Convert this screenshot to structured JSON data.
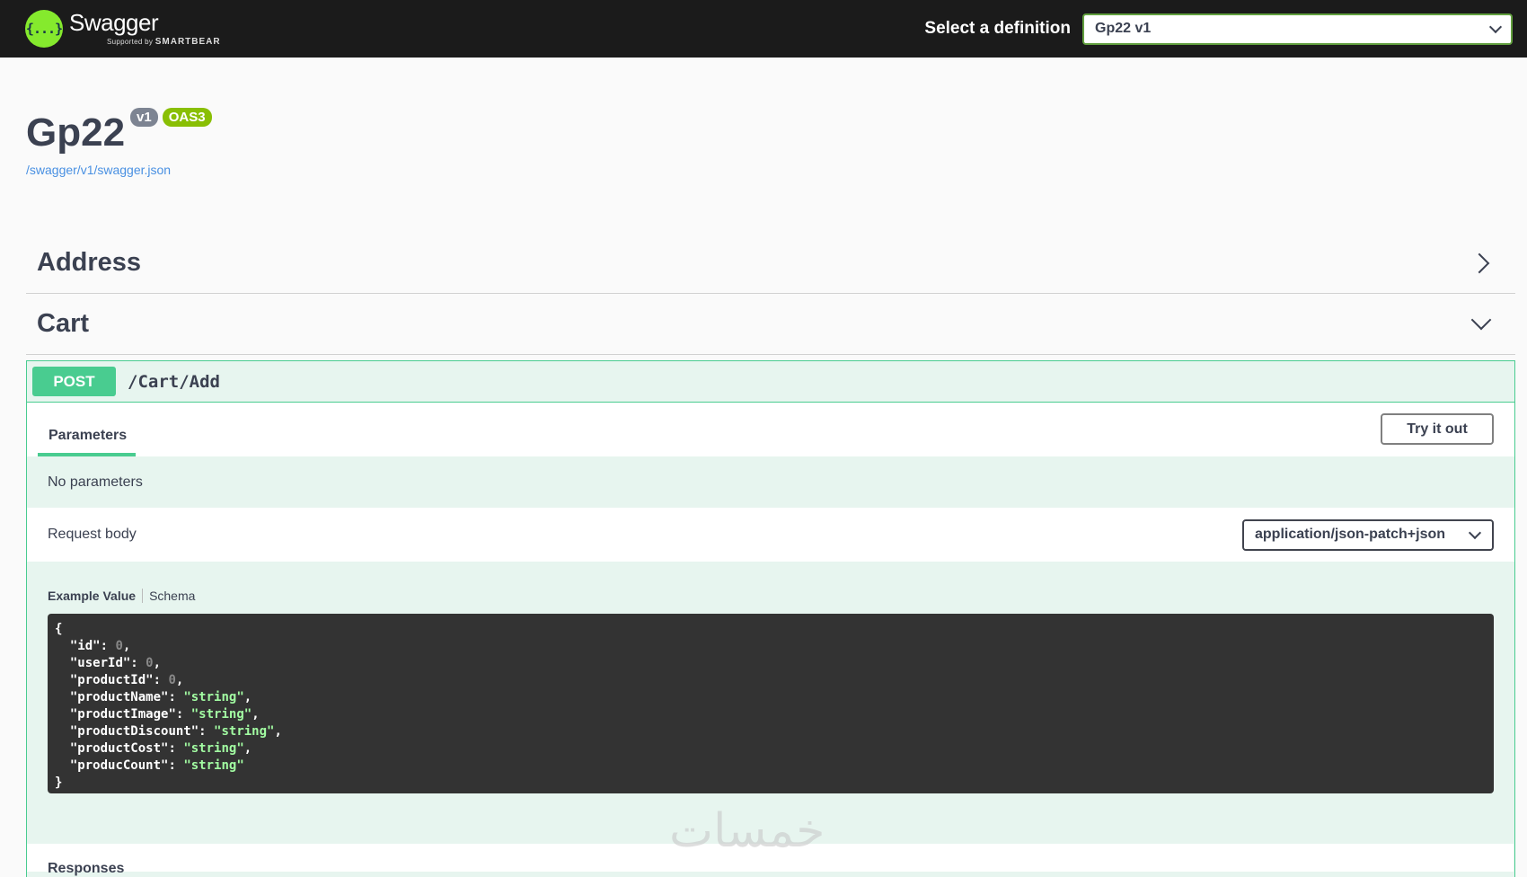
{
  "topbar": {
    "logo_icon": "{...}",
    "logo_name": "Swagger",
    "logo_supported_by": "Supported by",
    "logo_company": "SMARTBEAR",
    "definition_label": "Select a definition",
    "definition_value": "Gp22 v1"
  },
  "info": {
    "title": "Gp22",
    "version_badge": "v1",
    "oas_badge": "OAS3",
    "spec_url": "/swagger/v1/swagger.json"
  },
  "tags": [
    {
      "name": "Address",
      "expanded": false
    },
    {
      "name": "Cart",
      "expanded": true
    }
  ],
  "operation": {
    "method": "POST",
    "path": "/Cart/Add",
    "parameters_tab": "Parameters",
    "try_button": "Try it out",
    "no_parameters": "No parameters",
    "request_body_label": "Request body",
    "content_type": "application/json-patch+json",
    "example_tab": "Example Value",
    "schema_tab": "Schema",
    "example_fields": [
      {
        "key": "id",
        "value": "0",
        "type": "number"
      },
      {
        "key": "userId",
        "value": "0",
        "type": "number"
      },
      {
        "key": "productId",
        "value": "0",
        "type": "number"
      },
      {
        "key": "productName",
        "value": "string",
        "type": "string"
      },
      {
        "key": "productImage",
        "value": "string",
        "type": "string"
      },
      {
        "key": "productDiscount",
        "value": "string",
        "type": "string"
      },
      {
        "key": "productCost",
        "value": "string",
        "type": "string"
      },
      {
        "key": "producCount",
        "value": "string",
        "type": "string"
      }
    ],
    "responses_label": "Responses"
  },
  "watermark": "خمسات",
  "colors": {
    "topbar": "#1b1b1b",
    "post": "#49cc90",
    "oas": "#89bf04",
    "link": "#4990e2"
  }
}
